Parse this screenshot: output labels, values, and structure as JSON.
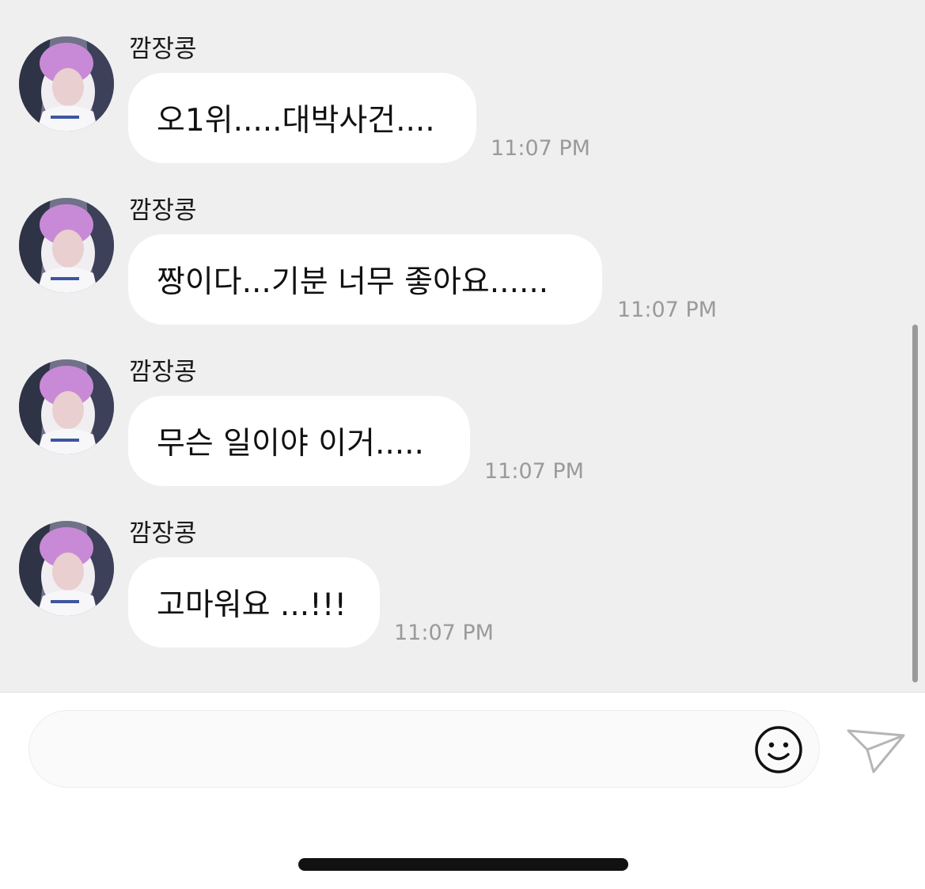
{
  "messages": [
    {
      "sender": "깜장콩",
      "text": "오1위.....대박사건....",
      "time": "11:07 PM"
    },
    {
      "sender": "깜장콩",
      "text": "짱이다...기분 너무 좋아요......",
      "time": "11:07 PM"
    },
    {
      "sender": "깜장콩",
      "text": "무슨 일이야 이거.....",
      "time": "11:07 PM"
    },
    {
      "sender": "깜장콩",
      "text": "고마워요 ...!!!",
      "time": "11:07 PM"
    }
  ],
  "composer": {
    "value": "",
    "placeholder": "",
    "emoji_icon": "smiley-icon",
    "send_icon": "paper-plane-icon"
  },
  "colors": {
    "chat_background": "#efeff0",
    "bubble": "#ffffff",
    "timestamp": "#9a9a9a"
  }
}
